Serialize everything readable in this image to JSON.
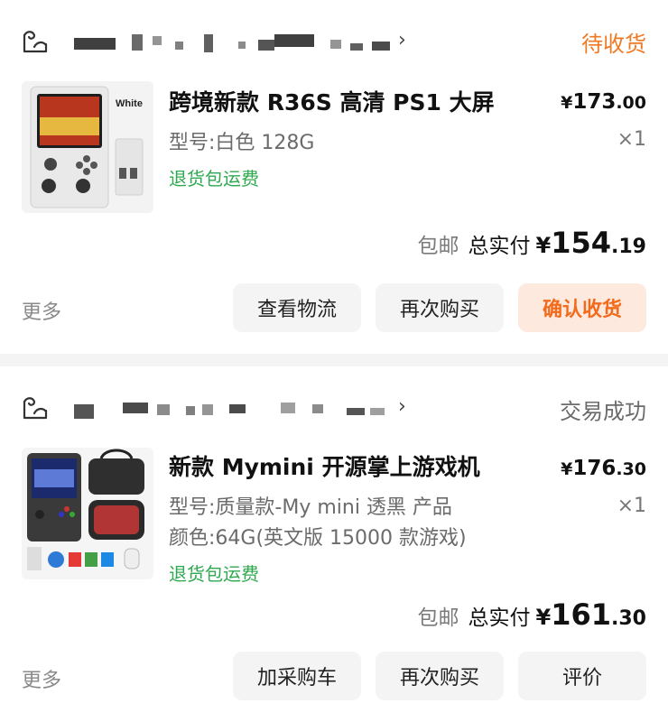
{
  "orders": [
    {
      "status": "待收货",
      "status_color": "#ef7a24",
      "product": {
        "image_label": "White",
        "title": "跨境新款 R36S 高清 PS1 大屏",
        "spec_lines": [
          "型号:白色 128G"
        ],
        "return_tag": "退货包运费",
        "price_symbol": "¥",
        "price_int": "173",
        "price_dec": ".00",
        "quantity": "×1"
      },
      "shipping": "包邮",
      "total_label": "总实付",
      "total_symbol": "¥",
      "total_int": "154",
      "total_dec": ".19",
      "more": "更多",
      "buttons": [
        "查看物流",
        "再次购买",
        "确认收货"
      ]
    },
    {
      "status": "交易成功",
      "status_color": "#6b6b6b",
      "product": {
        "title": "新款 Mymini 开源掌上游戏机",
        "spec_lines": [
          "型号:质量款-My mini 透黑 产品",
          "颜色:64G(英文版 15000 款游戏)"
        ],
        "return_tag": "退货包运费",
        "price_symbol": "¥",
        "price_int": "176",
        "price_dec": ".30",
        "quantity": "×1"
      },
      "shipping": "包邮",
      "total_label": "总实付",
      "total_symbol": "¥",
      "total_int": "161",
      "total_dec": ".30",
      "more": "更多",
      "buttons": [
        "加采购车",
        "再次购买",
        "评价"
      ]
    }
  ],
  "colors": {
    "accent": "#f26a1b",
    "accent_bg": "#fde9dd",
    "return_green": "#2fa84f",
    "button_bg": "#f4f4f4"
  },
  "icons": [
    "store-icon",
    "chevron-right-icon"
  ]
}
